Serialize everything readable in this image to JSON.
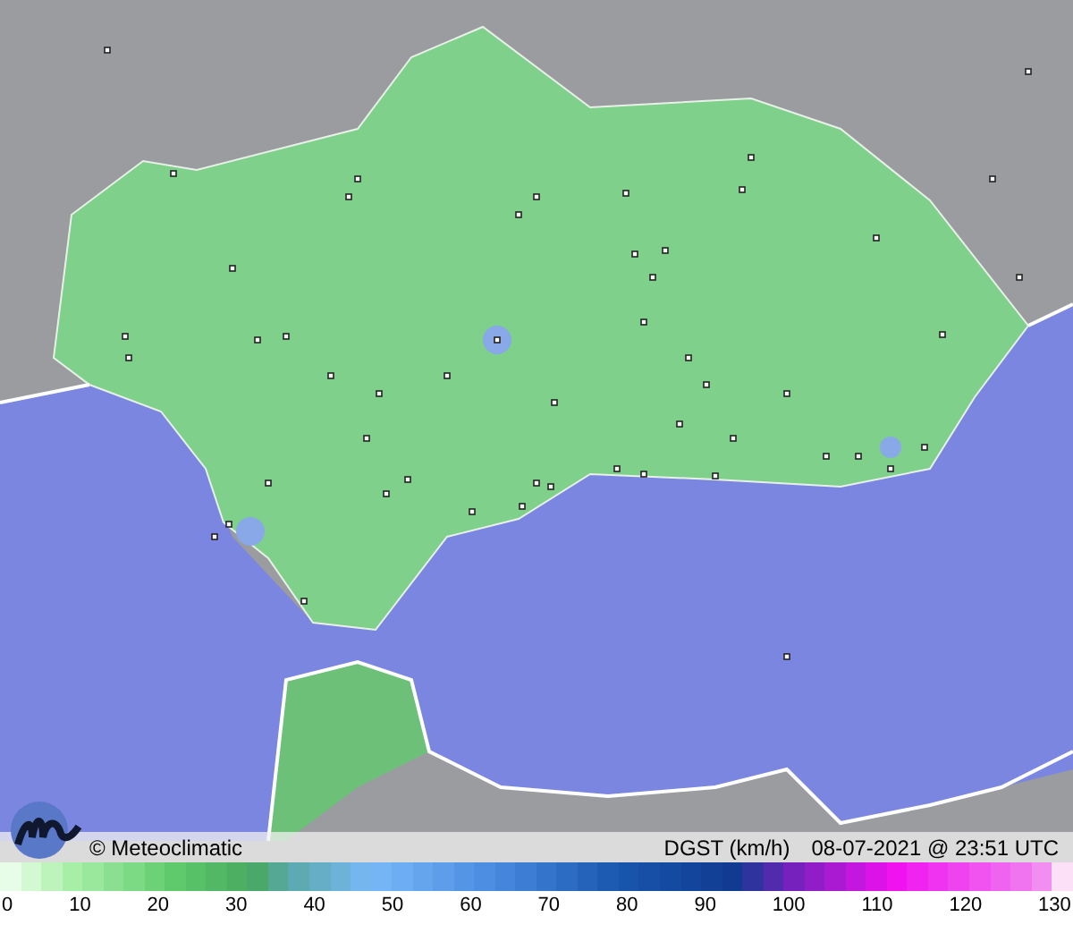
{
  "map": {
    "copyright": "© Meteoclimatic",
    "variable": "DGST (km/h)",
    "timestamp": "08-07-2021 @ 23:51 UTC"
  },
  "legend": {
    "ticks": [
      "0",
      "10",
      "20",
      "30",
      "40",
      "50",
      "60",
      "70",
      "80",
      "90",
      "100",
      "110",
      "120",
      "130"
    ]
  }
}
